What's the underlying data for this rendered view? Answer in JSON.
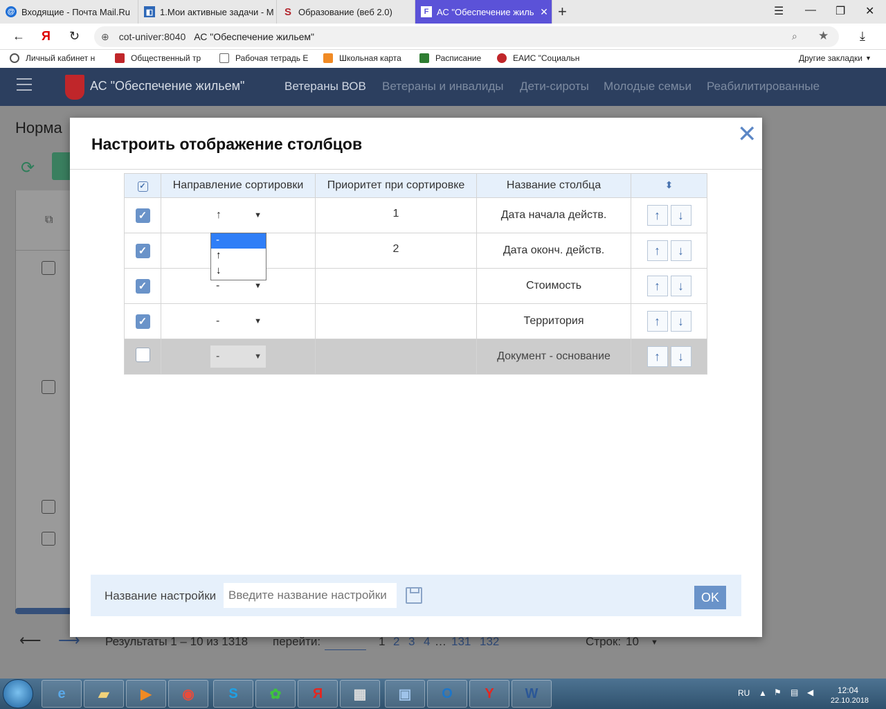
{
  "browser": {
    "tabs": [
      {
        "title": "Входящие - Почта Mail.Ru",
        "icon": "mail-ru-icon"
      },
      {
        "title": "1.Мои активные задачи - М",
        "icon": "tasks-icon"
      },
      {
        "title": "Образование (веб 2.0)",
        "icon": "s-logo-icon"
      },
      {
        "title": "АС \"Обеспечение жиль",
        "icon": "f-logo-icon",
        "active": true
      }
    ],
    "address_host": "cot-univer:8040",
    "address_title": "АС \"Обеспечение жильем\"",
    "bookmarks": [
      "Личный кабинет н",
      "Общественный тр",
      "Рабочая тетрадь Е",
      "Школьная карта",
      "Расписание",
      "ЕАИС \"Социальн"
    ],
    "other_bookmarks": "Другие закладки"
  },
  "app": {
    "title": "АС \"Обеспечение жильем\"",
    "nav": [
      "Ветераны ВОВ",
      "Ветераны и инвалиды",
      "Дети-сироты",
      "Молодые семьи",
      "Реабилитированные"
    ],
    "page_title": "Норма"
  },
  "modal": {
    "title": "Настроить отображение столбцов",
    "headers": {
      "sort_dir": "Направление сортировки",
      "priority": "Приоритет при сортировке",
      "name": "Название столбца"
    },
    "rows": [
      {
        "checked": true,
        "sort": "↑",
        "priority": "1",
        "name": "Дата начала действ."
      },
      {
        "checked": true,
        "sort": "↓",
        "priority": "2",
        "name": "Дата оконч. действ."
      },
      {
        "checked": true,
        "sort": "-",
        "priority": "",
        "name": "Стоимость"
      },
      {
        "checked": true,
        "sort": "-",
        "priority": "",
        "name": "Территория"
      },
      {
        "checked": false,
        "sort": "-",
        "priority": "",
        "name": "Документ - основание"
      }
    ],
    "dropdown_options": [
      "-",
      "↑",
      "↓"
    ],
    "footer": {
      "label": "Название настройки",
      "placeholder": "Введите название настройки",
      "ok": "OK"
    }
  },
  "pager": {
    "results": "Результаты 1 – 10 из 1318",
    "goto": "перейти:",
    "pages": [
      "1",
      "2",
      "3",
      "4",
      "…",
      "131",
      "132"
    ],
    "rows_label": "Строк:",
    "rows_value": "10"
  },
  "tray": {
    "lang": "RU",
    "time": "12:04",
    "date": "22.10.2018"
  }
}
